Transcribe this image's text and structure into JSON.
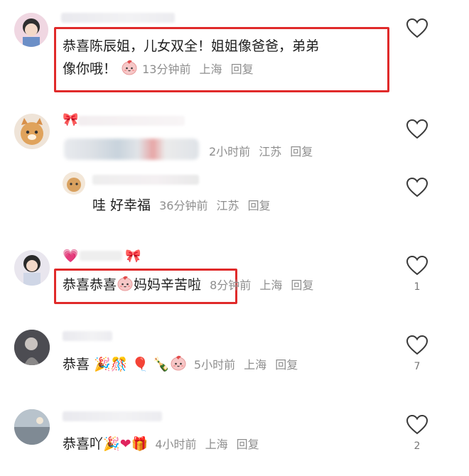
{
  "comments": [
    {
      "text_line1": "恭喜陈辰姐，儿女双全！姐姐像爸爸，弟弟",
      "text_line2": "像你哦！",
      "time": "13分钟前",
      "location": "上海",
      "reply": "回复",
      "likes": ""
    },
    {
      "text": "",
      "time": "2小时前",
      "location": "江苏",
      "reply": "回复",
      "likes": ""
    },
    {
      "text": "哇 好幸福",
      "time": "36分钟前",
      "location": "江苏",
      "reply": "回复",
      "likes": ""
    },
    {
      "text": "恭喜恭喜",
      "text_after_emoji": "妈妈辛苦啦",
      "time": "8分钟前",
      "location": "上海",
      "reply": "回复",
      "likes": "1"
    },
    {
      "text": "恭喜",
      "time": "5小时前",
      "location": "上海",
      "reply": "回复",
      "likes": "7"
    },
    {
      "text": "恭喜吖",
      "time": "4小时前",
      "location": "上海",
      "reply": "回复",
      "likes": "2"
    }
  ],
  "colors": {
    "highlight_box": "#e02a2a",
    "meta_text": "#8e8e8e"
  },
  "icons": [
    "heart-outline-icon",
    "peach-emoji-icon",
    "party-popper-icon",
    "balloon-icon",
    "champagne-icon",
    "heart-icon",
    "gift-icon",
    "bow-icon"
  ]
}
